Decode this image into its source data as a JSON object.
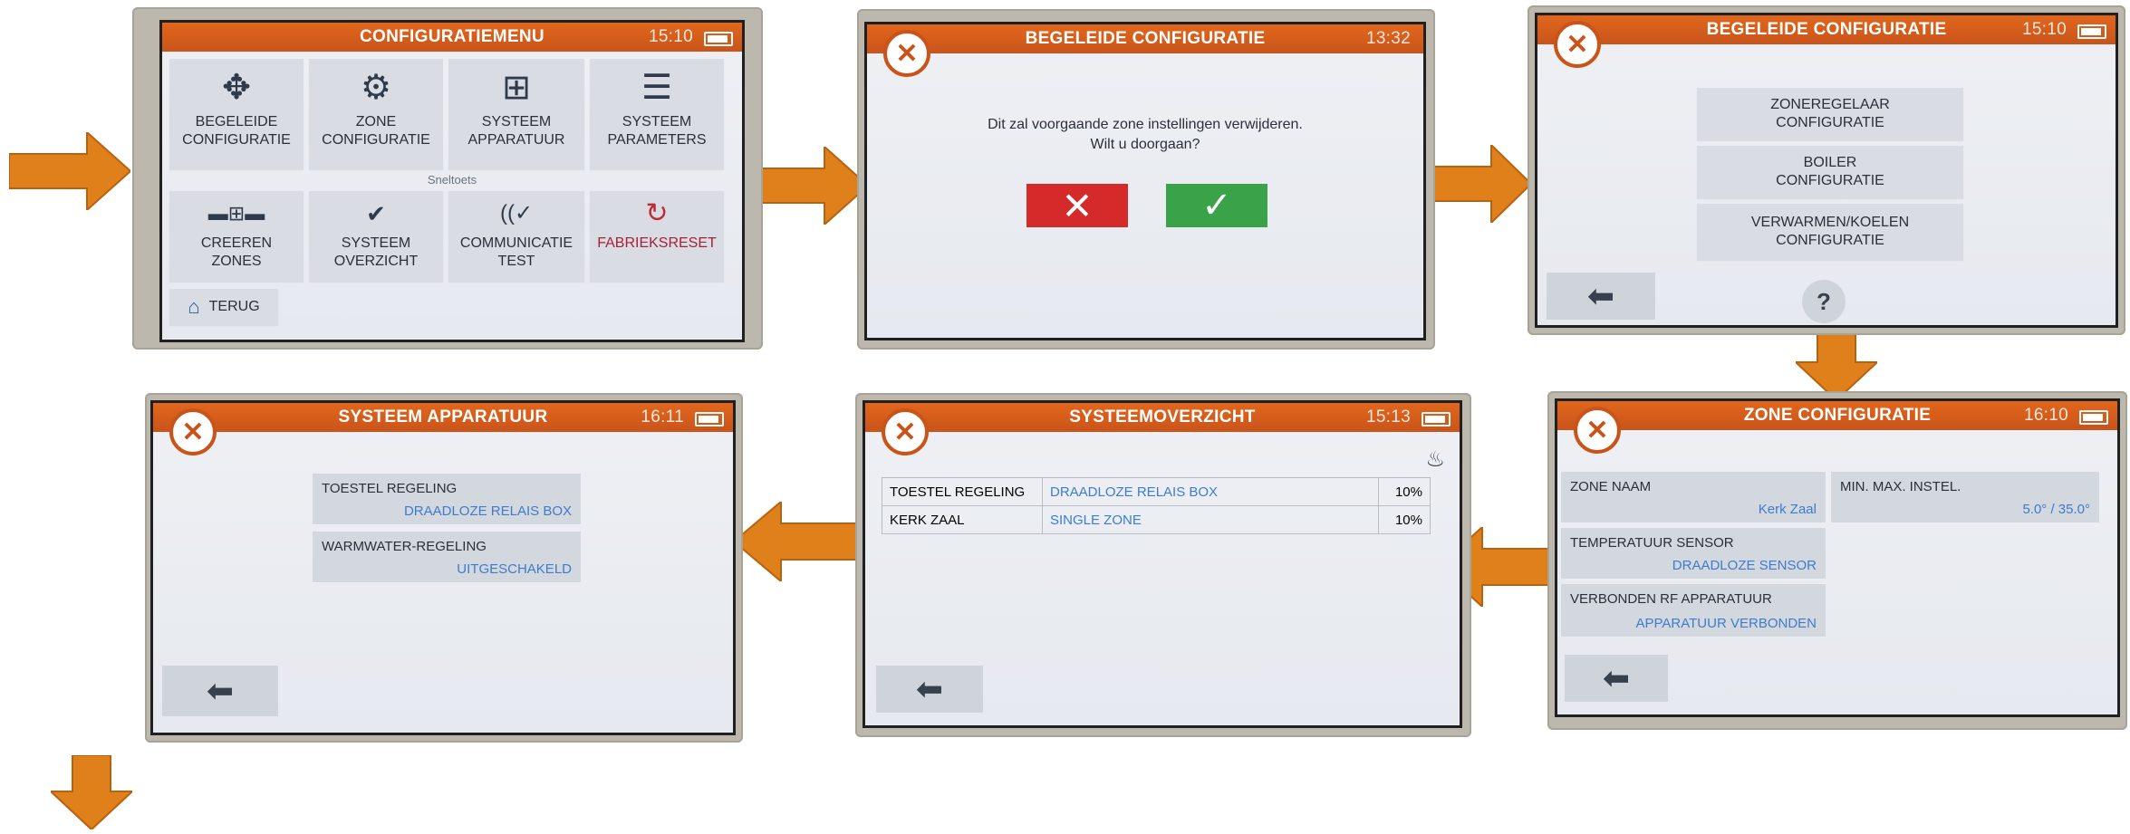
{
  "colors": {
    "accent": "#e2671d",
    "arrow": "#e0801b",
    "red": "#d42a2a",
    "green": "#3aa34a",
    "value_blue": "#3d7ccf"
  },
  "screens": {
    "config_menu": {
      "title": "CONFIGURATIEMENU",
      "time": "15:10",
      "tiles_row1": [
        {
          "label1": "BEGELEIDE",
          "label2": "CONFIGURATIE",
          "icon": "wrench-wand-icon"
        },
        {
          "label1": "ZONE",
          "label2": "CONFIGURATIE",
          "icon": "zone-gear-icon"
        },
        {
          "label1": "SYSTEEM",
          "label2": "APPARATUUR",
          "icon": "network-devices-icon"
        },
        {
          "label1": "SYSTEEM",
          "label2": "PARAMETERS",
          "icon": "list-icon"
        }
      ],
      "shortcuts_label": "Sneltoets",
      "tiles_row2": [
        {
          "label1": "CREEREN",
          "label2": "ZONES",
          "icon": "create-zones-icon"
        },
        {
          "label1": "SYSTEEM",
          "label2": "OVERZICHT",
          "icon": "check-circle-icon"
        },
        {
          "label1": "COMMUNICATIE",
          "label2": "TEST",
          "icon": "signal-check-icon"
        },
        {
          "label1": "FABRIEKSRESET",
          "label2": "",
          "icon": "reset-icon"
        }
      ],
      "back_label": "TERUG"
    },
    "guided_confirm": {
      "title": "BEGELEIDE CONFIGURATIE",
      "time": "13:32",
      "message_line1": "Dit zal voorgaande zone instellingen verwijderen.",
      "message_line2": "Wilt u doorgaan?"
    },
    "guided_menu": {
      "title": "BEGELEIDE CONFIGURATIE",
      "time": "15:10",
      "options": [
        {
          "line1": "ZONEREGELAAR",
          "line2": "CONFIGURATIE"
        },
        {
          "line1": "BOILER",
          "line2": "CONFIGURATIE"
        },
        {
          "line1": "VERWARMEN/KOELEN",
          "line2": "CONFIGURATIE"
        }
      ],
      "help": "?"
    },
    "zone_config": {
      "title": "ZONE CONFIGURATIE",
      "time": "16:10",
      "rows": [
        {
          "key": "ZONE NAAM",
          "value": "Kerk Zaal"
        },
        {
          "key": "TEMPERATUUR SENSOR",
          "value": "DRAADLOZE SENSOR"
        },
        {
          "key": "VERBONDEN RF APPARATUUR",
          "value": "APPARATUUR VERBONDEN"
        }
      ],
      "minmax_key": "MIN. MAX. INSTEL.",
      "minmax_value": "5.0° / 35.0°"
    },
    "system_overview": {
      "title": "SYSTEEMOVERZICHT",
      "time": "15:13",
      "rows": [
        {
          "c1": "TOESTEL REGELING",
          "c2": "DRAADLOZE RELAIS BOX",
          "c3": "10%"
        },
        {
          "c1": "KERK ZAAL",
          "c2": "SINGLE ZONE",
          "c3": "10%"
        }
      ]
    },
    "system_devices": {
      "title": "SYSTEEM APPARATUUR",
      "time": "16:11",
      "rows": [
        {
          "key": "TOESTEL REGELING",
          "value": "DRAADLOZE RELAIS BOX"
        },
        {
          "key": "WARMWATER-REGELING",
          "value": "UITGESCHAKELD"
        }
      ]
    }
  }
}
